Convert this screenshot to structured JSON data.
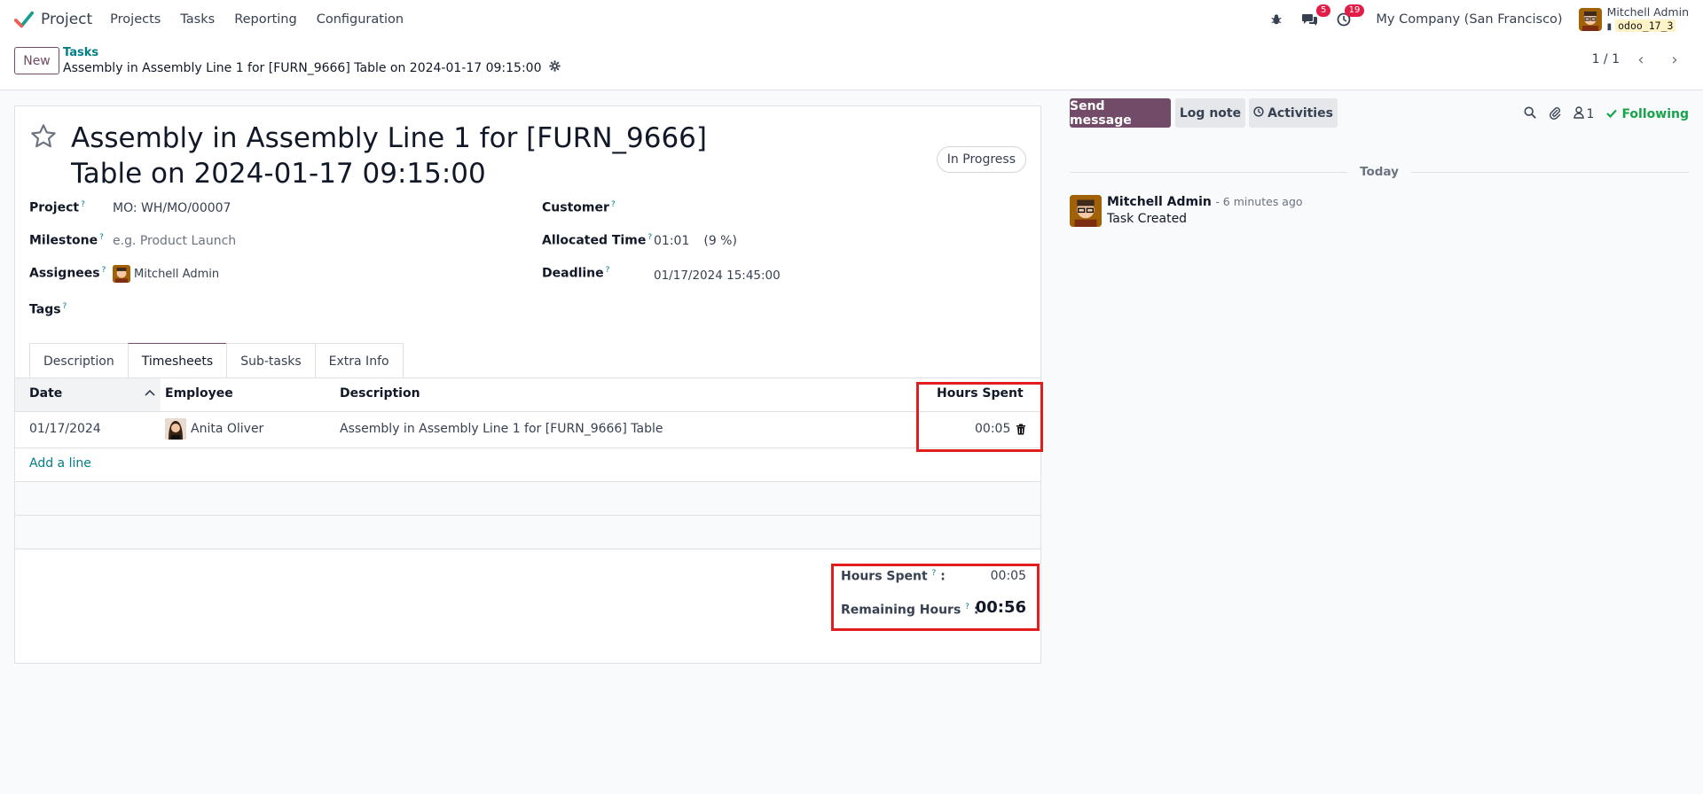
{
  "navbar": {
    "app_name": "Project",
    "menu": [
      "Projects",
      "Tasks",
      "Reporting",
      "Configuration"
    ],
    "messages_count": "5",
    "activities_count": "19",
    "company": "My Company (San Francisco)",
    "user_name": "Mitchell Admin",
    "database": "odoo_17_3"
  },
  "control": {
    "new_label": "New",
    "breadcrumb_parent": "Tasks",
    "breadcrumb_current": "Assembly in Assembly Line 1 for [FURN_9666] Table on 2024-01-17 09:15:00",
    "pager": "1 / 1"
  },
  "form": {
    "title": "Assembly in Assembly Line 1 for [FURN_9666] Table on 2024-01-17 09:15:00",
    "stage": "In Progress",
    "fields": {
      "project_label": "Project",
      "project_value": "MO: WH/MO/00007",
      "milestone_label": "Milestone",
      "milestone_placeholder": "e.g. Product Launch",
      "assignees_label": "Assignees",
      "assignee_value": "Mitchell Admin",
      "tags_label": "Tags",
      "customer_label": "Customer",
      "allocated_label": "Allocated Time",
      "allocated_value": "01:01",
      "allocated_pct": "(9 %)",
      "deadline_label": "Deadline",
      "deadline_value": "01/17/2024 15:45:00"
    },
    "help_mark": "?",
    "tabs": [
      "Description",
      "Timesheets",
      "Sub-tasks",
      "Extra Info"
    ],
    "active_tab": "Timesheets",
    "timesheet": {
      "columns": [
        "Date",
        "Employee",
        "Description",
        "Hours Spent"
      ],
      "rows": [
        {
          "date": "01/17/2024",
          "employee": "Anita Oliver",
          "description": "Assembly in Assembly Line 1 for [FURN_9666] Table",
          "hours": "00:05"
        }
      ],
      "add_line": "Add a line"
    },
    "totals": {
      "hours_spent_label": "Hours Spent",
      "hours_spent_value": "00:05",
      "remaining_label": "Remaining Hours",
      "remaining_value": "00:56",
      "colon": ":"
    }
  },
  "chatter": {
    "send_message": "Send message",
    "log_note": "Log note",
    "activities": "Activities",
    "followers_count": "1",
    "following": "Following",
    "date_separator": "Today",
    "messages": [
      {
        "author": "Mitchell Admin",
        "date": "- 6 minutes ago",
        "body": "Task Created"
      }
    ]
  },
  "colors": {
    "brand": "#714b67",
    "link": "#017e84",
    "highlight": "#e11d1d",
    "following": "#16a34a"
  }
}
